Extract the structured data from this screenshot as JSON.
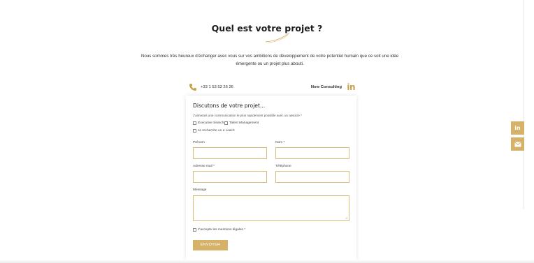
{
  "page": {
    "title": "Quel est votre projet ?",
    "intro_line1": "Nous sommes très heureux d'échanger avec vous sur vos ambitions de développement de votre potentiel humain que ce soit une idée",
    "intro_line2": "émergente ou un projet plus abouti."
  },
  "contact": {
    "phone": "+33 1 53 53 26 26",
    "company": "Now Consulting",
    "linkedin_label": "in"
  },
  "form": {
    "heading": "Discutons de votre projet...",
    "subtitle": "J'aimerais une communication le plus rapidement possible avec un associé",
    "options": [
      "Executive Search",
      "Talent Management",
      "Je recherche un e coach"
    ],
    "fields": {
      "firstname_label": "Prénom",
      "lastname_label": "Nom",
      "email_label": "Adresse mail",
      "phone_label": "Téléphone",
      "message_label": "Message"
    },
    "required_mark": "*",
    "legal": "J'accepte les mentions légales",
    "submit": "ENVOYER"
  },
  "sidebar": {
    "linkedin_icon": "linkedin-icon",
    "mail_icon": "mail-icon"
  },
  "colors": {
    "accent": "#d5b268",
    "text": "#222222"
  }
}
